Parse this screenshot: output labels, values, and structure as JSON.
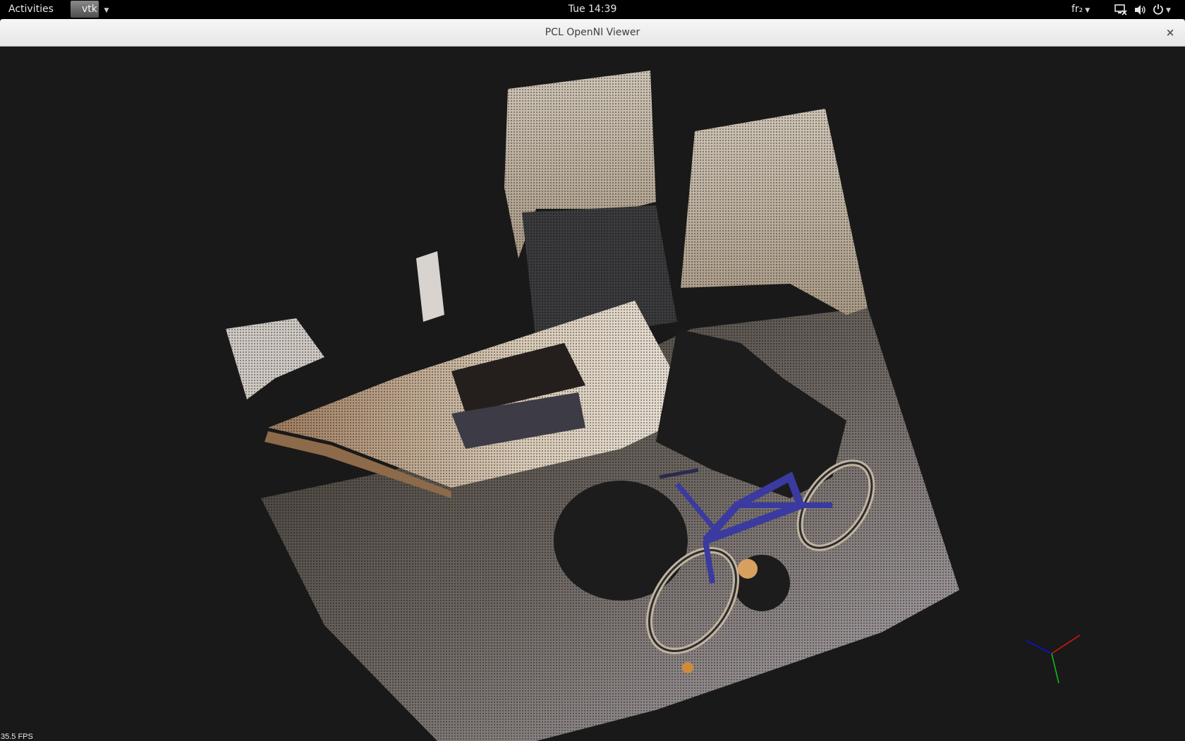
{
  "topbar": {
    "activities_label": "Activities",
    "app_name": "vtk",
    "clock": "Tue 14:39",
    "keyboard_layout": "fr₂",
    "icons": [
      "network-icon",
      "volume-icon",
      "power-icon"
    ]
  },
  "window": {
    "title": "PCL OpenNI Viewer",
    "close_glyph": "×"
  },
  "viewer": {
    "fps_text": "35.5 FPS",
    "axes_colors": {
      "x": "#e01010",
      "y": "#10c010",
      "z": "#1010d0"
    },
    "background": "#191919"
  }
}
